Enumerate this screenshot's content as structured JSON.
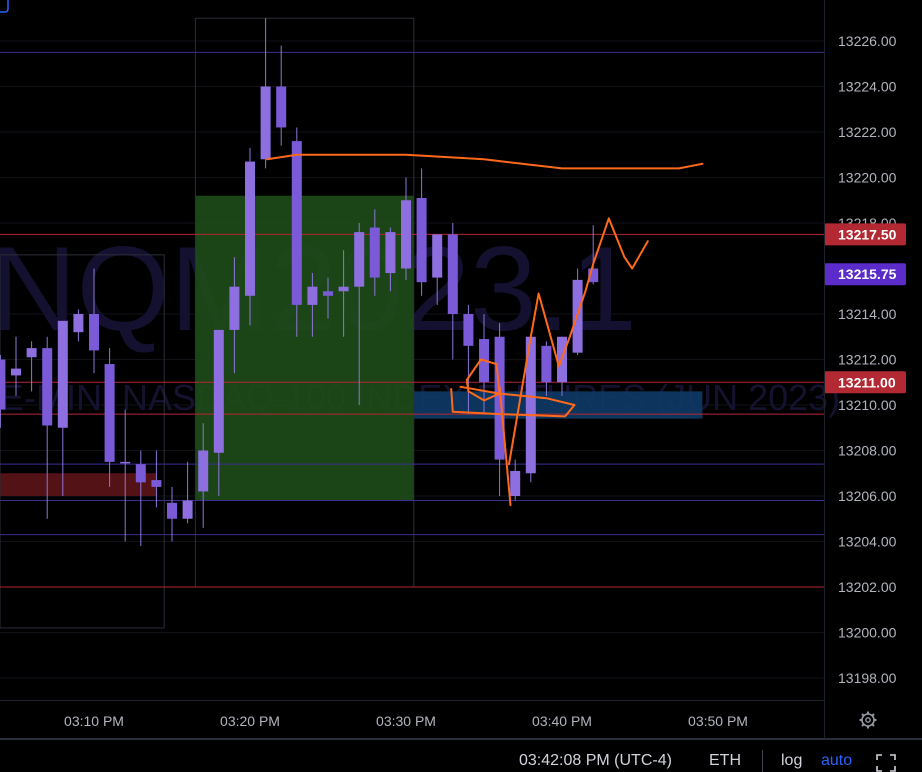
{
  "chart_data": {
    "type": "candlestick",
    "watermark": {
      "symbol": "NQM2023.1",
      "description": "E-MINI NASDAQ-100 INDEX FUTURES (JUN 2023)"
    },
    "price_axis": {
      "ticks": [
        "13226.00",
        "13224.00",
        "13222.00",
        "13220.00",
        "13218.00",
        "13214.00",
        "13212.00",
        "13210.00",
        "13208.00",
        "13206.00",
        "13204.00",
        "13202.00",
        "13200.00",
        "13198.00"
      ],
      "ylim": [
        13197,
        13228
      ]
    },
    "time_axis": {
      "ticks": [
        {
          "label": "03:10 PM",
          "idx": 0
        },
        {
          "label": "03:20 PM",
          "idx": 10
        },
        {
          "label": "03:30 PM",
          "idx": 20
        },
        {
          "label": "03:40 PM",
          "idx": 30
        },
        {
          "label": "03:50 PM",
          "idx": 40
        }
      ],
      "first_idx": -6,
      "last_idx": 44
    },
    "price_labels": [
      {
        "value": "13217.50",
        "price": 13217.5,
        "color": "#b22833"
      },
      {
        "value": "13215.75",
        "price": 13215.75,
        "color": "#5b2cc9"
      },
      {
        "value": "13211.00",
        "price": 13211.0,
        "color": "#b22833"
      }
    ],
    "candles": [
      {
        "idx": -6,
        "o": 13212.0,
        "h": 13212.2,
        "c": 13209.8,
        "l": 13209.0
      },
      {
        "idx": -5,
        "o": 13211.3,
        "h": 13213.0,
        "c": 13211.6,
        "l": 13210.4
      },
      {
        "idx": -4,
        "o": 13212.1,
        "h": 13212.8,
        "c": 13212.5,
        "l": 13210.6
      },
      {
        "idx": -3,
        "o": 13212.5,
        "h": 13213.0,
        "c": 13209.1,
        "l": 13205.0
      },
      {
        "idx": -2,
        "o": 13209.0,
        "h": 13210.2,
        "c": 13213.7,
        "l": 13206.0
      },
      {
        "idx": -1,
        "o": 13213.2,
        "h": 13214.2,
        "c": 13214.0,
        "l": 13212.8
      },
      {
        "idx": 0,
        "o": 13214.0,
        "h": 13216.0,
        "c": 13212.4,
        "l": 13211.4
      },
      {
        "idx": 1,
        "o": 13211.8,
        "h": 13212.5,
        "c": 13207.5,
        "l": 13206.4
      },
      {
        "idx": 2,
        "o": 13207.5,
        "h": 13209.8,
        "c": 13207.5,
        "l": 13204.0
      },
      {
        "idx": 3,
        "o": 13207.4,
        "h": 13208.0,
        "c": 13206.6,
        "l": 13203.8
      },
      {
        "idx": 4,
        "o": 13206.7,
        "h": 13208.0,
        "c": 13206.4,
        "l": 13205.5
      },
      {
        "idx": 5,
        "o": 13205.7,
        "h": 13206.4,
        "c": 13205.0,
        "l": 13204.0
      },
      {
        "idx": 6,
        "o": 13205.0,
        "h": 13207.5,
        "c": 13205.8,
        "l": 13204.8
      },
      {
        "idx": 7,
        "o": 13206.2,
        "h": 13209.2,
        "c": 13208.0,
        "l": 13204.6
      },
      {
        "idx": 8,
        "o": 13207.9,
        "h": 13213.3,
        "c": 13213.3,
        "l": 13206.0
      },
      {
        "idx": 9,
        "o": 13213.3,
        "h": 13216.5,
        "c": 13215.2,
        "l": 13211.4
      },
      {
        "idx": 10,
        "o": 13214.8,
        "h": 13221.3,
        "c": 13220.7,
        "l": 13213.5
      },
      {
        "idx": 11,
        "o": 13220.8,
        "h": 13227.0,
        "c": 13224.0,
        "l": 13220.4
      },
      {
        "idx": 12,
        "o": 13224.0,
        "h": 13225.8,
        "c": 13222.2,
        "l": 13221.4
      },
      {
        "idx": 13,
        "o": 13221.6,
        "h": 13222.2,
        "c": 13214.4,
        "l": 13213.0
      },
      {
        "idx": 14,
        "o": 13214.4,
        "h": 13215.8,
        "c": 13215.2,
        "l": 13213.0
      },
      {
        "idx": 15,
        "o": 13215.0,
        "h": 13215.6,
        "c": 13214.8,
        "l": 13213.8
      },
      {
        "idx": 16,
        "o": 13215.0,
        "h": 13216.8,
        "c": 13215.2,
        "l": 13213.0
      },
      {
        "idx": 17,
        "o": 13215.2,
        "h": 13218.0,
        "c": 13217.6,
        "l": 13210.0
      },
      {
        "idx": 18,
        "o": 13217.8,
        "h": 13218.6,
        "c": 13215.6,
        "l": 13214.8
      },
      {
        "idx": 19,
        "o": 13215.8,
        "h": 13217.8,
        "c": 13217.6,
        "l": 13215.0
      },
      {
        "idx": 20,
        "o": 13216.0,
        "h": 13220.0,
        "c": 13219.0,
        "l": 13215.5
      },
      {
        "idx": 21,
        "o": 13219.1,
        "h": 13220.4,
        "c": 13215.4,
        "l": 13214.8
      },
      {
        "idx": 22,
        "o": 13215.6,
        "h": 13217.4,
        "c": 13217.5,
        "l": 13214.4
      },
      {
        "idx": 23,
        "o": 13217.5,
        "h": 13218.0,
        "c": 13214.0,
        "l": 13212.0
      },
      {
        "idx": 24,
        "o": 13214.0,
        "h": 13214.4,
        "c": 13212.6,
        "l": 13209.6
      },
      {
        "idx": 25,
        "o": 13212.9,
        "h": 13214.0,
        "c": 13211.0,
        "l": 13209.6
      },
      {
        "idx": 26,
        "o": 13213.0,
        "h": 13213.6,
        "c": 13207.6,
        "l": 13206.0
      },
      {
        "idx": 27,
        "o": 13206.0,
        "h": 13207.6,
        "c": 13207.1,
        "l": 13205.8
      },
      {
        "idx": 28,
        "o": 13207.0,
        "h": 13213.0,
        "c": 13213.0,
        "l": 13206.6
      },
      {
        "idx": 29,
        "o": 13212.6,
        "h": 13212.8,
        "c": 13211.0,
        "l": 13210.4
      },
      {
        "idx": 30,
        "o": 13211.0,
        "h": 13213.0,
        "c": 13213.0,
        "l": 13210.4
      },
      {
        "idx": 31,
        "o": 13212.3,
        "h": 13216.0,
        "c": 13215.5,
        "l": 13212.2
      },
      {
        "idx": 32,
        "o": 13216.0,
        "h": 13217.9,
        "c": 13215.4,
        "l": 13215.3
      }
    ],
    "horizontal_lines": [
      {
        "price": 13225.5,
        "color": "#3b2e8f"
      },
      {
        "price": 13217.5,
        "color": "#b22833"
      },
      {
        "price": 13211.0,
        "color": "#b22833"
      },
      {
        "price": 13209.6,
        "color": "#b22833"
      },
      {
        "price": 13207.4,
        "color": "#3b2e8f"
      },
      {
        "price": 13205.8,
        "color": "#3b2e8f"
      },
      {
        "price": 13204.3,
        "color": "#3b2e8f"
      },
      {
        "price": 13202.0,
        "color": "#b22833"
      }
    ],
    "zones": [
      {
        "type": "green",
        "from_idx": 6.5,
        "to_idx": 20.5,
        "top": 13219.2,
        "bottom": 13205.8,
        "color": "#1e4d1a"
      },
      {
        "type": "red",
        "from_idx": -8,
        "to_idx": 4,
        "top": 13207.0,
        "bottom": 13206.0,
        "color": "#5c1418"
      },
      {
        "type": "blue",
        "from_idx": 20.5,
        "to_idx": 39,
        "top": 13210.6,
        "bottom": 13209.4,
        "color": "#0e3a66"
      }
    ],
    "session_boxes": [
      {
        "from_idx": 6.5,
        "to_idx": 20.5,
        "top": 13227.0,
        "bottom": 13202.0
      },
      {
        "from_idx": -8,
        "to_idx": 4.5,
        "top": 13216.6,
        "bottom": 13200.2
      }
    ],
    "drawings": [
      {
        "name": "resistance-stroke",
        "points": [
          [
            11.1,
            13220.8
          ],
          [
            13,
            13221.0
          ],
          [
            20,
            13221.0
          ],
          [
            25,
            13220.8
          ],
          [
            30,
            13220.4
          ],
          [
            35,
            13220.4
          ],
          [
            37.5,
            13220.4
          ],
          [
            39,
            13220.6
          ]
        ]
      },
      {
        "name": "price-projection-stroke",
        "points": [
          [
            26.6,
            13207.4
          ],
          [
            27.5,
            13211.0
          ],
          [
            28.0,
            13213.0
          ],
          [
            28.5,
            13214.9
          ],
          [
            29.8,
            13211.7
          ],
          [
            30.5,
            13213.0
          ],
          [
            31.5,
            13215.0
          ],
          [
            32,
            13216.2
          ],
          [
            33,
            13218.2
          ],
          [
            34,
            13216.5
          ],
          [
            34.5,
            13216.0
          ],
          [
            35.5,
            13217.2
          ]
        ]
      },
      {
        "name": "support-ellipse-stroke",
        "points": [
          [
            22.9,
            13210.7
          ],
          [
            23,
            13209.7
          ],
          [
            26,
            13209.6
          ],
          [
            30.2,
            13209.5
          ],
          [
            30.8,
            13210.0
          ],
          [
            29,
            13210.3
          ],
          [
            26,
            13210.5
          ],
          [
            23.5,
            13210.8
          ]
        ]
      },
      {
        "name": "entry-circle-stroke",
        "points": [
          [
            23.9,
            13211.1
          ],
          [
            24.8,
            13212.0
          ],
          [
            25.8,
            13211.8
          ],
          [
            26.0,
            13210.5
          ],
          [
            25.0,
            13210.2
          ],
          [
            24.0,
            13210.6
          ],
          [
            23.9,
            13211.1
          ]
        ]
      },
      {
        "name": "wick-mark-stroke",
        "points": [
          [
            26.7,
            13205.6
          ],
          [
            26.0,
            13210.8
          ]
        ]
      }
    ]
  },
  "status_bar": {
    "time": "03:42:08 PM (UTC-4)",
    "session": "ETH",
    "log_label": "log",
    "auto_label": "auto",
    "settings_icon": "gear-icon",
    "fullscreen_icon": "fullscreen-icon"
  }
}
